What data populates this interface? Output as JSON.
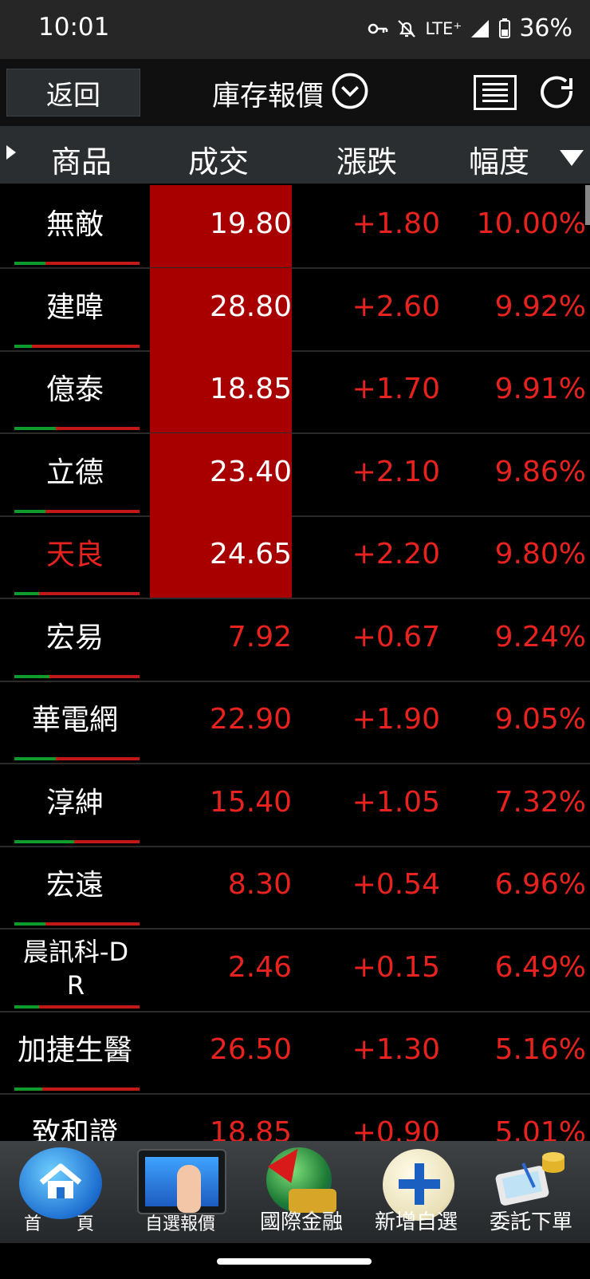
{
  "status_bar": {
    "time": "10:01",
    "network": "LTE⁺",
    "battery": "36%"
  },
  "header": {
    "back_label": "返回",
    "title": "庫存報價"
  },
  "columns": {
    "product": "商品",
    "price": "成交",
    "change": "漲跌",
    "percent": "幅度"
  },
  "rows": [
    {
      "name": "無敵",
      "price": "19.80",
      "change": "+1.80",
      "pct": "10.00%",
      "highlight": true,
      "name_red": false,
      "bar_green": 0.25
    },
    {
      "name": "建暐",
      "price": "28.80",
      "change": "+2.60",
      "pct": "9.92%",
      "highlight": true,
      "name_red": false,
      "bar_green": 0.14
    },
    {
      "name": "億泰",
      "price": "18.85",
      "change": "+1.70",
      "pct": "9.91%",
      "highlight": true,
      "name_red": false,
      "bar_green": 0.33
    },
    {
      "name": "立德",
      "price": "23.40",
      "change": "+2.10",
      "pct": "9.86%",
      "highlight": true,
      "name_red": false,
      "bar_green": 0.25
    },
    {
      "name": "天良",
      "price": "24.65",
      "change": "+2.20",
      "pct": "9.80%",
      "highlight": true,
      "name_red": true,
      "bar_green": 0.2
    },
    {
      "name": "宏易",
      "price": "7.92",
      "change": "+0.67",
      "pct": "9.24%",
      "highlight": false,
      "name_red": false,
      "bar_green": 0.28
    },
    {
      "name": "華電網",
      "price": "22.90",
      "change": "+1.90",
      "pct": "9.05%",
      "highlight": false,
      "name_red": false,
      "bar_green": 0.33
    },
    {
      "name": "淳紳",
      "price": "15.40",
      "change": "+1.05",
      "pct": "7.32%",
      "highlight": false,
      "name_red": false,
      "bar_green": 0.48
    },
    {
      "name": "宏遠",
      "price": "8.30",
      "change": "+0.54",
      "pct": "6.96%",
      "highlight": false,
      "name_red": false,
      "bar_green": 0.25
    },
    {
      "name": "晨訊科-DR",
      "price": "2.46",
      "change": "+0.15",
      "pct": "6.49%",
      "highlight": false,
      "name_red": false,
      "bar_green": 0.2
    },
    {
      "name": "加捷生醫",
      "price": "26.50",
      "change": "+1.30",
      "pct": "5.16%",
      "highlight": false,
      "name_red": false,
      "bar_green": 0.22
    },
    {
      "name": "致和證",
      "price": "18.85",
      "change": "+0.90",
      "pct": "5.01%",
      "highlight": false,
      "name_red": false,
      "bar_green": 0.25
    }
  ],
  "bottom_nav": {
    "home": "首　　頁",
    "watchlist": "自選報價",
    "intl": "國際金融",
    "add": "新增自選",
    "order": "委託下單"
  },
  "colors": {
    "up_red": "#e8221e",
    "highlight_bg": "#a80000",
    "header_bg": "#2b2e31"
  }
}
